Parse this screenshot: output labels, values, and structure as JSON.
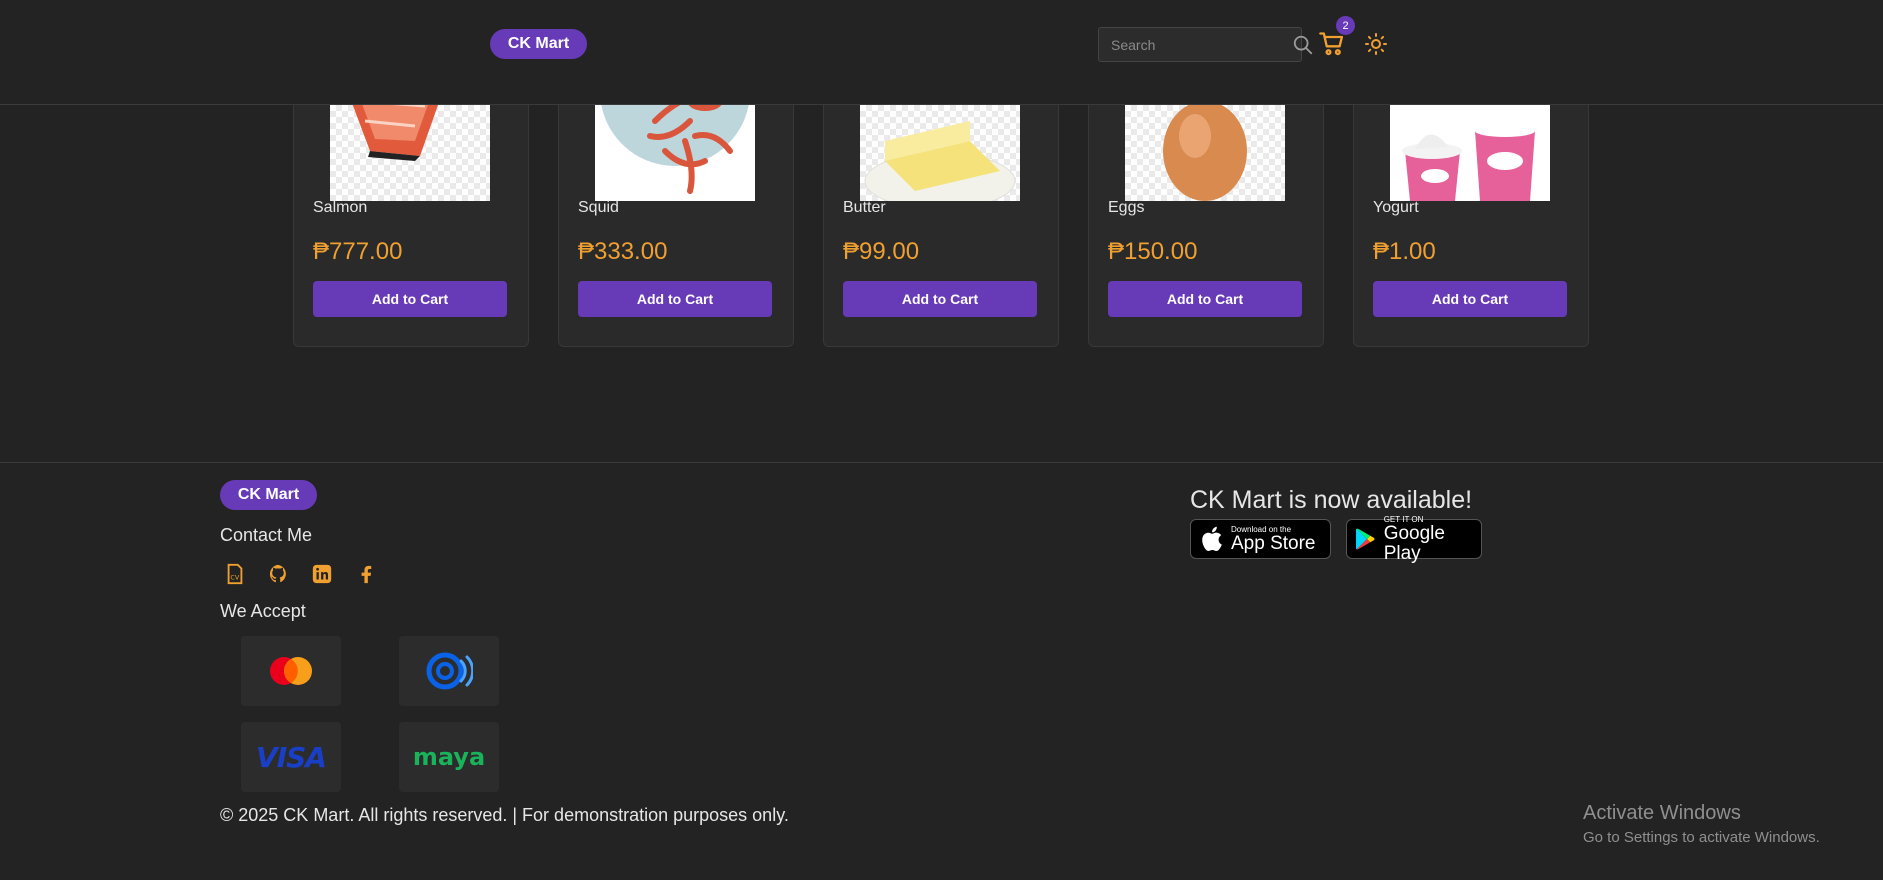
{
  "header": {
    "brand": "CK Mart",
    "search_placeholder": "Search",
    "cart_count": "2",
    "icons": [
      "search-icon",
      "cart-icon",
      "sun-icon"
    ],
    "accent_color": "#673ab7"
  },
  "products": [
    {
      "name": "Salmon",
      "price": "₱777.00",
      "button": "Add to Cart",
      "image": "salmon"
    },
    {
      "name": "Squid",
      "price": "₱333.00",
      "button": "Add to Cart",
      "image": "squid"
    },
    {
      "name": "Butter",
      "price": "₱99.00",
      "button": "Add to Cart",
      "image": "butter"
    },
    {
      "name": "Eggs",
      "price": "₱150.00",
      "button": "Add to Cart",
      "image": "egg"
    },
    {
      "name": "Yogurt",
      "price": "₱1.00",
      "button": "Add to Cart",
      "image": "yogurt"
    }
  ],
  "footer": {
    "brand": "CK Mart",
    "contact_heading": "Contact Me",
    "social_icons": [
      "cv-icon",
      "github-icon",
      "linkedin-icon",
      "facebook-icon"
    ],
    "accept_heading": "We Accept",
    "payments": [
      "mastercard",
      "gcash",
      "visa",
      "maya"
    ],
    "visa_text": "VISA",
    "maya_text": "maya",
    "available_text": "CK Mart is now available!",
    "app_store": {
      "small": "Download on the",
      "big": "App Store"
    },
    "google_play": {
      "small": "GET IT ON",
      "big": "Google Play"
    },
    "copyright": "© 2025 CK Mart. All rights reserved. | For demonstration purposes only."
  },
  "watermark": {
    "title": "Activate Windows",
    "subtitle": "Go to Settings to activate Windows."
  },
  "colors": {
    "price": "#f0a030",
    "icon": "#f0a030",
    "background": "#232323"
  }
}
